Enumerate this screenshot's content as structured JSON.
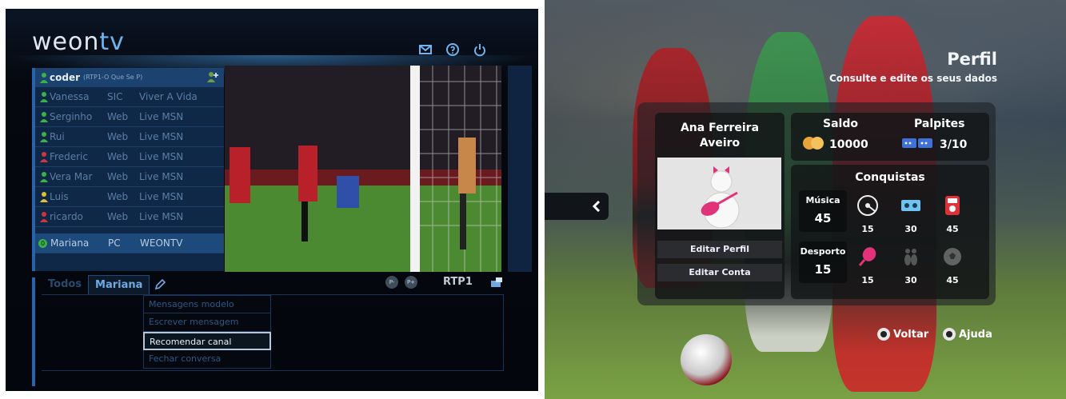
{
  "left": {
    "logo": {
      "main": "weon",
      "accent": "tv"
    },
    "header_icons": [
      "mail-icon",
      "help-icon",
      "power-icon"
    ],
    "current_user": {
      "name": "coder",
      "status": "(RTP1-O Que Se P)"
    },
    "contacts": [
      {
        "name": "Vanessa",
        "source": "SIC",
        "activity": "Viver A Vida",
        "color": "#3bb14a"
      },
      {
        "name": "Serginho",
        "source": "Web",
        "activity": "Live MSN",
        "color": "#3bb14a"
      },
      {
        "name": "Rui",
        "source": "Web",
        "activity": "Live MSN",
        "color": "#3bb14a"
      },
      {
        "name": "Frederic",
        "source": "Web",
        "activity": "Live MSN",
        "color": "#d0353f"
      },
      {
        "name": "Vera Mar",
        "source": "Web",
        "activity": "Live MSN",
        "color": "#3bb14a"
      },
      {
        "name": "Luis",
        "source": "Web",
        "activity": "Live MSN",
        "color": "#e0c030"
      },
      {
        "name": "ricardo",
        "source": "Web",
        "activity": "Live MSN",
        "color": "#d0353f"
      }
    ],
    "selected_contact": {
      "badge": "0",
      "name": "Mariana",
      "source": "PC",
      "activity": "WEONTV"
    },
    "channel": {
      "prev": "P-",
      "next": "P+",
      "name": "RTP1"
    },
    "tabs": [
      "Todos",
      "Mariana"
    ],
    "menu": [
      "Mensagens modelo",
      "Escrever mensagem",
      "Recomendar canal",
      "Fechar conversa"
    ],
    "menu_highlight_index": 2
  },
  "right": {
    "title": "Perfil",
    "subtitle": "Consulte e edite os seus dados",
    "profile": {
      "name_line1": "Ana Ferreira",
      "name_line2": "Aveiro"
    },
    "buttons": {
      "edit_profile": "Editar Perfil",
      "edit_account": "Editar Conta"
    },
    "saldo": {
      "label": "Saldo",
      "value": "10000"
    },
    "palpites": {
      "label": "Palpites",
      "value": "3/10"
    },
    "conquistas": {
      "title": "Conquistas",
      "musica": {
        "label": "Música",
        "value": "45",
        "achievements": [
          "15",
          "30",
          "45"
        ]
      },
      "desporto": {
        "label": "Desporto",
        "value": "15",
        "achievements": [
          "15",
          "30",
          "45"
        ]
      }
    },
    "footer": {
      "back": "Voltar",
      "help": "Ajuda"
    }
  }
}
